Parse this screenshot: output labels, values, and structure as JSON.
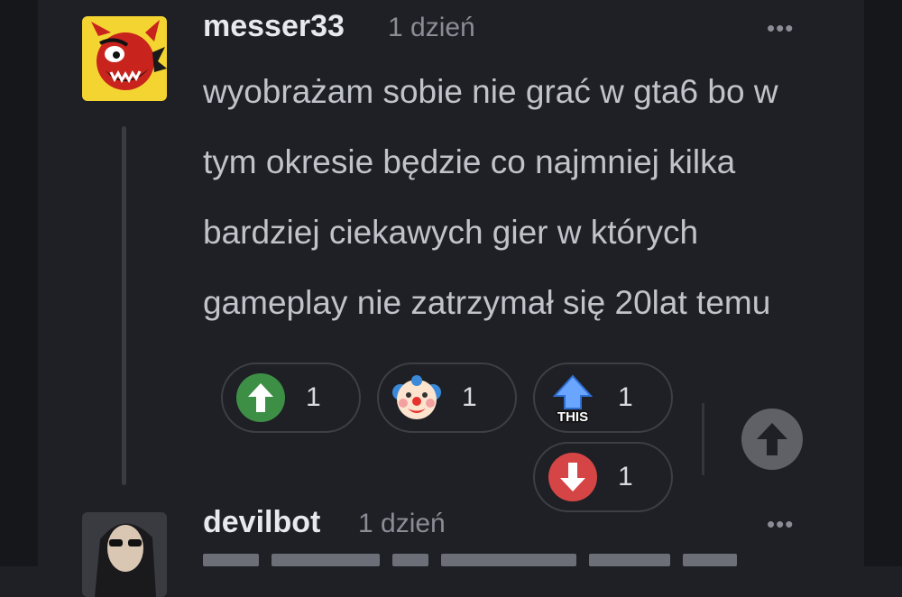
{
  "comment": {
    "username": "messer33",
    "time": "1 dzień",
    "more_label": "•••",
    "text": "wyobrażam sobie nie grać w gta6 bo w tym okresie będzie co najmniej kilka bardziej ciekawych gier w których gameplay nie zatrzymał się 20lat temu",
    "avatar_icon": "devil-avatar-icon"
  },
  "reactions": {
    "upvote": {
      "icon": "green-up-arrow-icon",
      "count": "1"
    },
    "clown": {
      "icon": "clown-icon",
      "count": "1"
    },
    "this": {
      "icon": "this-arrow-icon",
      "label": "THIS",
      "count": "1"
    },
    "downvote": {
      "icon": "red-down-arrow-icon",
      "count": "1"
    }
  },
  "reply_button": {
    "icon": "up-arrow-icon"
  },
  "next_comment": {
    "username": "devilbot",
    "time": "1 dzień",
    "more_label": "•••",
    "avatar_icon": "sunglasses-avatar-icon"
  },
  "colors": {
    "background": "#1f2025",
    "upvote_green": "#3d8f45",
    "downvote_red": "#d64545",
    "this_blue": "#6aa6ff"
  }
}
